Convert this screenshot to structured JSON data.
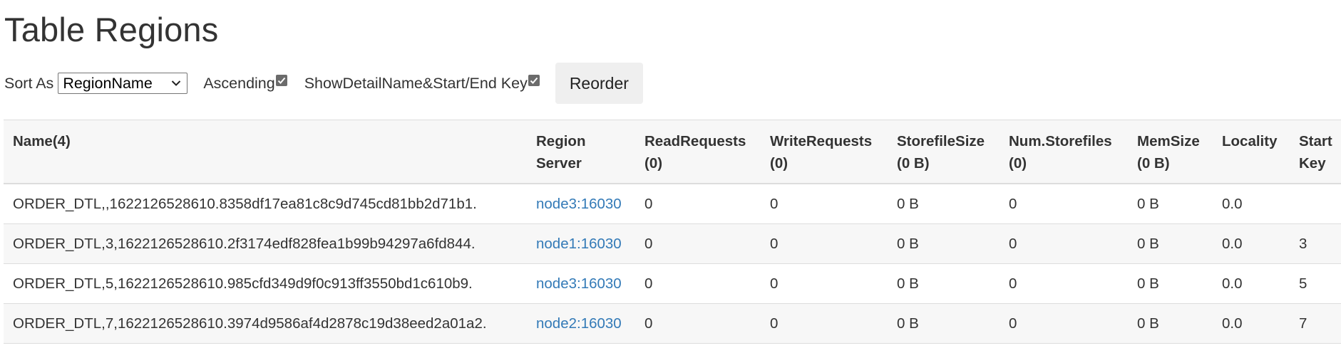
{
  "page_title": "Table Regions",
  "controls": {
    "sort_as_label": "Sort As",
    "sort_selected": "RegionName",
    "ascending_label": "Ascending",
    "ascending_checked": true,
    "show_detail_label": "ShowDetailName&Start/End Key",
    "show_detail_checked": true,
    "reorder_label": "Reorder"
  },
  "table": {
    "headers": [
      {
        "line1": "Name(4)",
        "line2": ""
      },
      {
        "line1": "Region",
        "line2": "Server"
      },
      {
        "line1": "ReadRequests",
        "line2": "(0)"
      },
      {
        "line1": "WriteRequests",
        "line2": "(0)"
      },
      {
        "line1": "StorefileSize",
        "line2": "(0 B)"
      },
      {
        "line1": "Num.Storefiles",
        "line2": "(0)"
      },
      {
        "line1": "MemSize",
        "line2": "(0 B)"
      },
      {
        "line1": "Locality",
        "line2": ""
      },
      {
        "line1": "Start",
        "line2": "Key"
      }
    ],
    "rows": [
      {
        "name": "ORDER_DTL,,1622126528610.8358df17ea81c8c9d745cd81bb2d71b1.",
        "server": "node3:16030",
        "read": "0",
        "write": "0",
        "storefile_size": "0 B",
        "num_storefiles": "0",
        "memsize": "0 B",
        "locality": "0.0",
        "start_key": ""
      },
      {
        "name": "ORDER_DTL,3,1622126528610.2f3174edf828fea1b99b94297a6fd844.",
        "server": "node1:16030",
        "read": "0",
        "write": "0",
        "storefile_size": "0 B",
        "num_storefiles": "0",
        "memsize": "0 B",
        "locality": "0.0",
        "start_key": "3"
      },
      {
        "name": "ORDER_DTL,5,1622126528610.985cfd349d9f0c913ff3550bd1c610b9.",
        "server": "node3:16030",
        "read": "0",
        "write": "0",
        "storefile_size": "0 B",
        "num_storefiles": "0",
        "memsize": "0 B",
        "locality": "0.0",
        "start_key": "5"
      },
      {
        "name": "ORDER_DTL,7,1622126528610.3974d9586af4d2878c19d38eed2a01a2.",
        "server": "node2:16030",
        "read": "0",
        "write": "0",
        "storefile_size": "0 B",
        "num_storefiles": "0",
        "memsize": "0 B",
        "locality": "0.0",
        "start_key": "7"
      }
    ]
  }
}
